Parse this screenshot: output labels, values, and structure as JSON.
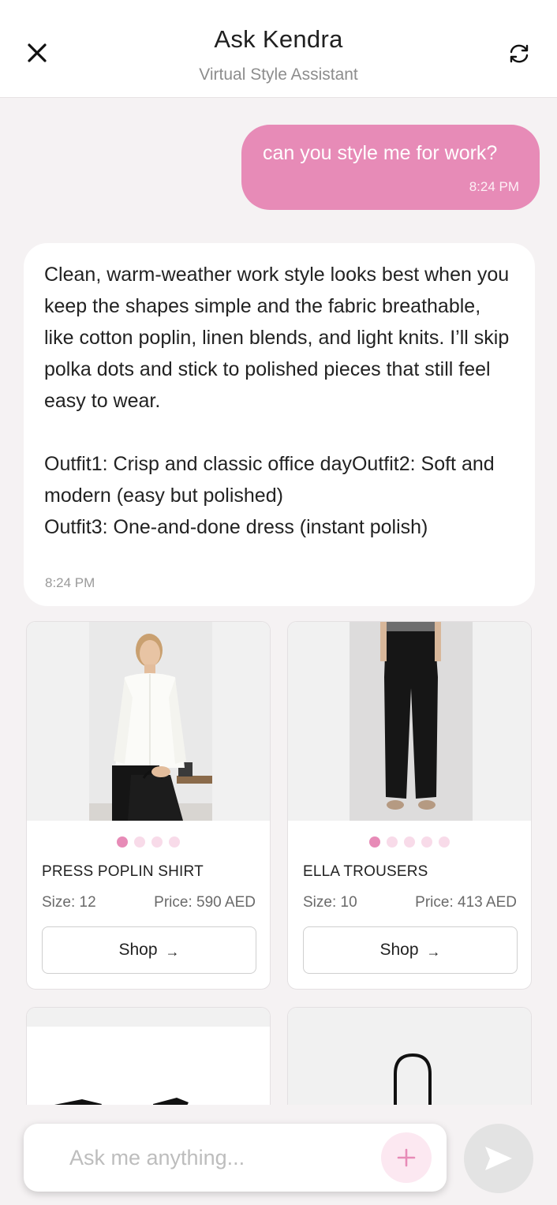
{
  "header": {
    "title": "Ask Kendra",
    "subtitle": "Virtual Style Assistant"
  },
  "messages": {
    "user": {
      "text": "can you style me for work?",
      "time": "8:24 PM"
    },
    "assistant": {
      "para1": "Clean, warm-weather work style looks best when you keep the shapes simple and the fabric breathable, like cotton poplin, linen blends, and light knits. I’ll skip polka dots and stick to polished pieces that still feel easy to wear.",
      "outfit_line1": "Outfit1: Crisp and classic office dayOutfit2: Soft and modern (easy but polished)",
      "outfit_line2": "Outfit3: One-and-done dress (instant polish)",
      "time": "8:24 PM"
    }
  },
  "products": [
    {
      "name": "PRESS POPLIN SHIRT",
      "size": "Size: 12",
      "price": "Price: 590 AED",
      "shop_label": "Shop",
      "image_dots": 4,
      "active_dot": 0
    },
    {
      "name": "ELLA TROUSERS",
      "size": "Size: 10",
      "price": "Price: 413 AED",
      "shop_label": "Shop",
      "image_dots": 5,
      "active_dot": 0
    }
  ],
  "input": {
    "placeholder": "Ask me anything..."
  },
  "colors": {
    "accent_pink": "#e78bb7",
    "dot_inactive": "#f8dbe9",
    "background": "#f5f2f3"
  },
  "icons": {
    "close": "close-icon",
    "refresh": "refresh-icon",
    "plus": "plus-icon",
    "send": "send-icon",
    "arrow": "arrow-right-icon"
  }
}
